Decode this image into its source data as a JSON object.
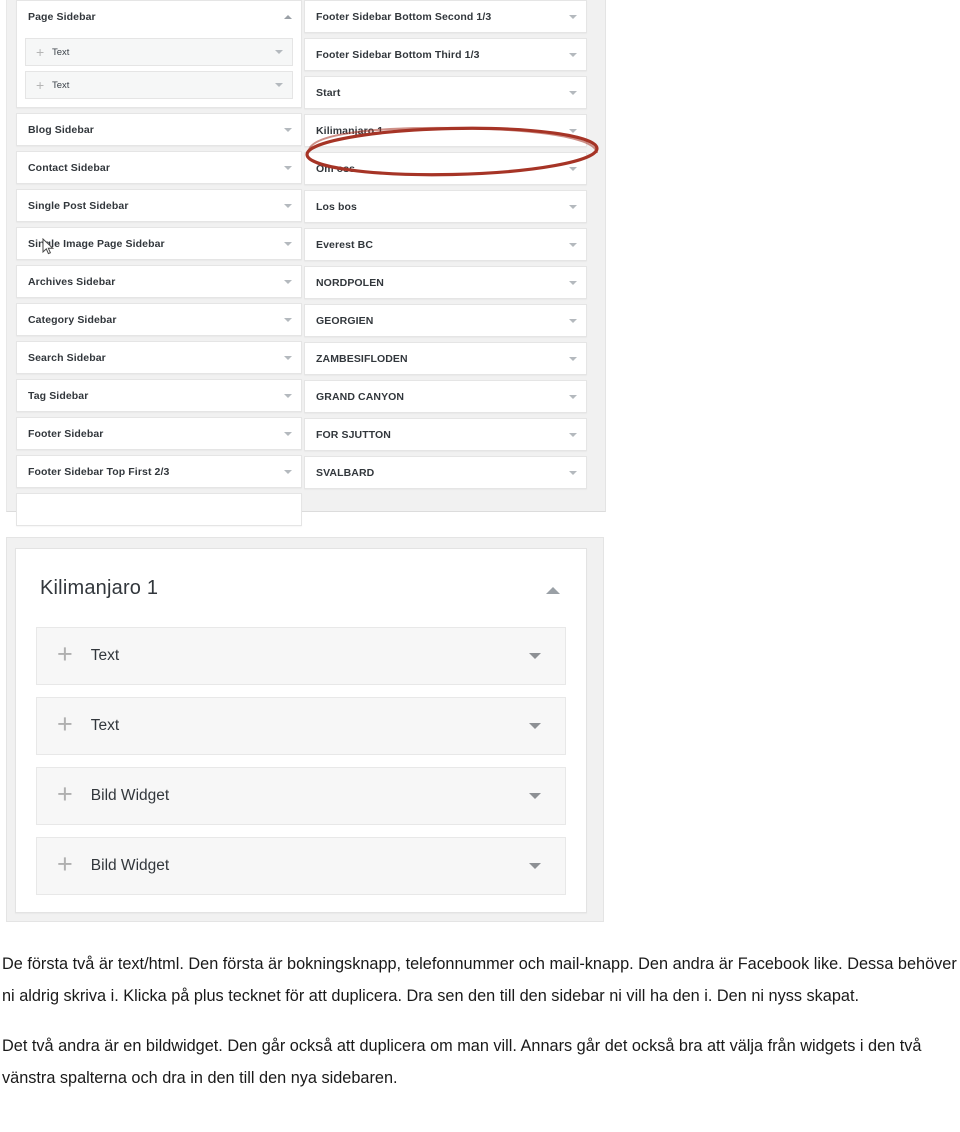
{
  "screenshot_top": {
    "name": "widget-areas-two-column-list",
    "left_column": [
      {
        "label": "Page Sidebar",
        "state": "expanded",
        "caret": "caret-up-icon",
        "widgets": [
          {
            "label": "Text",
            "icon": "plus-icon",
            "caret": "caret-down-icon"
          },
          {
            "label": "Text",
            "icon": "plus-icon",
            "caret": "caret-down-icon"
          }
        ]
      },
      {
        "label": "Blog Sidebar",
        "state": "collapsed",
        "caret": "caret-down-icon",
        "widgets": []
      },
      {
        "label": "Contact Sidebar",
        "state": "collapsed",
        "caret": "caret-down-icon",
        "widgets": []
      },
      {
        "label": "Single Post Sidebar",
        "state": "collapsed",
        "caret": "caret-down-icon",
        "widgets": []
      },
      {
        "label": "Single Image Page Sidebar",
        "state": "collapsed",
        "caret": "caret-down-icon",
        "widgets": []
      },
      {
        "label": "Archives Sidebar",
        "state": "collapsed",
        "caret": "caret-down-icon",
        "widgets": []
      },
      {
        "label": "Category Sidebar",
        "state": "collapsed",
        "caret": "caret-down-icon",
        "widgets": []
      },
      {
        "label": "Search Sidebar",
        "state": "collapsed",
        "caret": "caret-down-icon",
        "widgets": []
      },
      {
        "label": "Tag Sidebar",
        "state": "collapsed",
        "caret": "caret-down-icon",
        "widgets": []
      },
      {
        "label": "Footer Sidebar",
        "state": "collapsed",
        "caret": "caret-down-icon",
        "widgets": []
      },
      {
        "label": "Footer Sidebar Top First 2/3",
        "state": "collapsed",
        "caret": "caret-down-icon",
        "widgets": []
      },
      {
        "label": "",
        "state": "collapsed-cutoff",
        "caret": "",
        "widgets": []
      }
    ],
    "right_column": [
      {
        "label": "Footer Sidebar Bottom Second 1/3",
        "state": "collapsed",
        "caret": "caret-down-icon"
      },
      {
        "label": "Footer Sidebar Bottom Third 1/3",
        "state": "collapsed",
        "caret": "caret-down-icon"
      },
      {
        "label": "Start",
        "state": "collapsed",
        "caret": "caret-down-icon"
      },
      {
        "label": "Kilimanjaro 1",
        "state": "collapsed",
        "caret": "caret-down-icon",
        "annotated": true
      },
      {
        "label": "Om oss",
        "state": "collapsed",
        "caret": "caret-down-icon"
      },
      {
        "label": "Los bos",
        "state": "collapsed",
        "caret": "caret-down-icon"
      },
      {
        "label": "Everest BC",
        "state": "collapsed",
        "caret": "caret-down-icon"
      },
      {
        "label": "NORDPOLEN",
        "state": "collapsed",
        "caret": "caret-down-icon"
      },
      {
        "label": "GEORGIEN",
        "state": "collapsed",
        "caret": "caret-down-icon"
      },
      {
        "label": "ZAMBESIFLODEN",
        "state": "collapsed",
        "caret": "caret-down-icon"
      },
      {
        "label": "GRAND CANYON",
        "state": "collapsed",
        "caret": "caret-down-icon"
      },
      {
        "label": "FOR SJUTTON",
        "state": "collapsed",
        "caret": "caret-down-icon"
      },
      {
        "label": "SVALBARD",
        "state": "collapsed",
        "caret": "caret-down-icon"
      }
    ],
    "annotation": {
      "shape": "ellipse",
      "color": "#a63426",
      "target_label": "Kilimanjaro 1"
    },
    "cursor": {
      "icon": "mouse-pointer-icon"
    }
  },
  "screenshot_bottom": {
    "name": "kilimanjaro-widget-area-expanded",
    "title": "Kilimanjaro 1",
    "caret": "caret-up-icon",
    "widgets": [
      {
        "label": "Text",
        "icon": "plus-icon",
        "caret": "caret-down-icon"
      },
      {
        "label": "Text",
        "icon": "plus-icon",
        "caret": "caret-down-icon"
      },
      {
        "label": "Bild Widget",
        "icon": "plus-icon",
        "caret": "caret-down-icon"
      },
      {
        "label": "Bild Widget",
        "icon": "plus-icon",
        "caret": "caret-down-icon"
      }
    ]
  },
  "prose": {
    "paragraph_1": "De första två är text/html. Den första är bokningsknapp, telefonnummer och mail-knapp. Den andra är Facebook like. Dessa behöver ni aldrig skriva i. Klicka på plus tecknet för att duplicera. Dra sen den till den sidebar ni vill ha den i. Den ni nyss skapat.",
    "paragraph_2": "Det två andra är en bildwidget. Den går också att duplicera om man vill. Annars går det också bra att välja från widgets i den två vänstra spalterna och dra in den till den nya sidebaren."
  },
  "icons": {
    "plus": "+",
    "caret_down": "▾",
    "caret_up": "▴"
  },
  "colors": {
    "panel_bg": "#f1f1f1",
    "card_bg": "#ffffff",
    "card_border": "#e5e5e5",
    "widget_bg": "#f6f7f7",
    "text": "#32373c",
    "caret": "#b4b9be",
    "annotation_red": "#a63426"
  }
}
